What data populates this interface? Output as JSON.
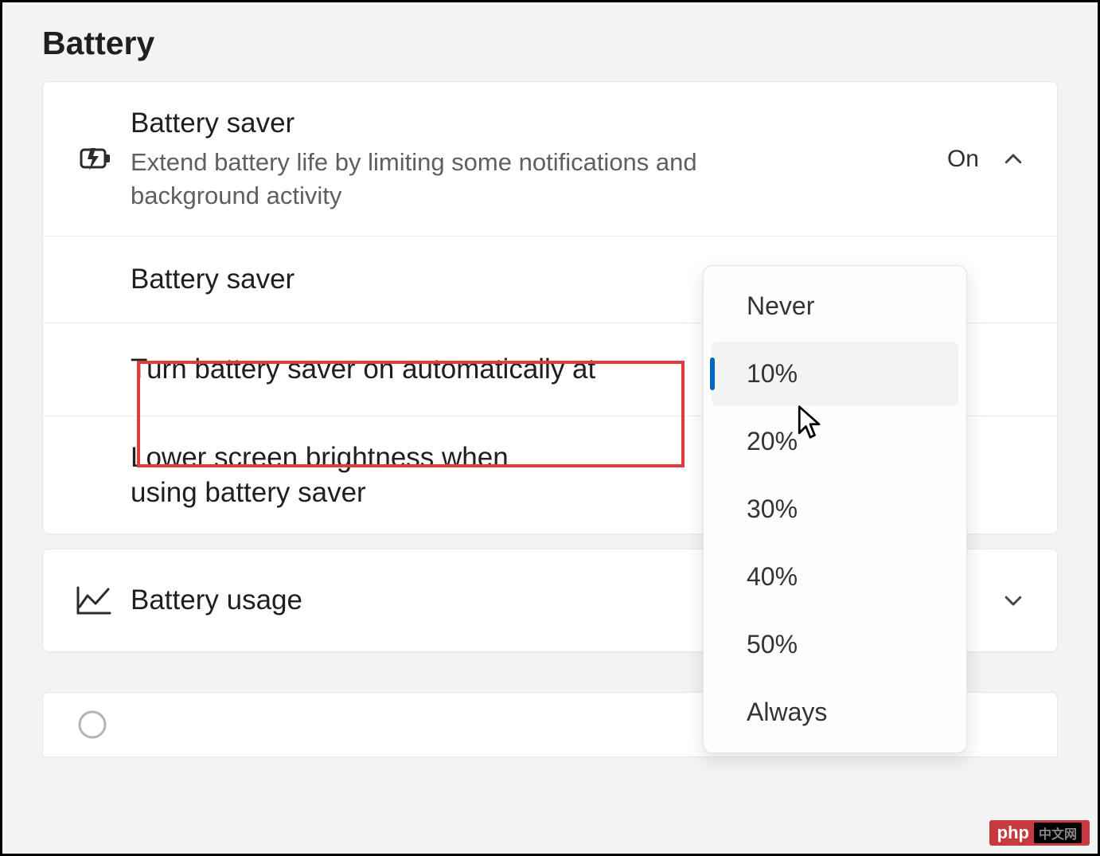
{
  "page": {
    "title": "Battery"
  },
  "battery_saver": {
    "header": {
      "title": "Battery saver",
      "description": "Extend battery life by limiting some notifications and background activity",
      "status": "On"
    },
    "rows": {
      "status_label": "Battery saver",
      "auto_on_label": "Turn battery saver on automatically at",
      "brightness_label": "Lower screen brightness when using battery saver"
    }
  },
  "battery_usage": {
    "title": "Battery usage"
  },
  "dropdown": {
    "options": [
      {
        "label": "Never",
        "selected": false
      },
      {
        "label": "10%",
        "selected": true
      },
      {
        "label": "20%",
        "selected": false
      },
      {
        "label": "30%",
        "selected": false
      },
      {
        "label": "40%",
        "selected": false
      },
      {
        "label": "50%",
        "selected": false
      },
      {
        "label": "Always",
        "selected": false
      }
    ]
  },
  "watermark": {
    "text": "php",
    "sub": "中文网"
  }
}
